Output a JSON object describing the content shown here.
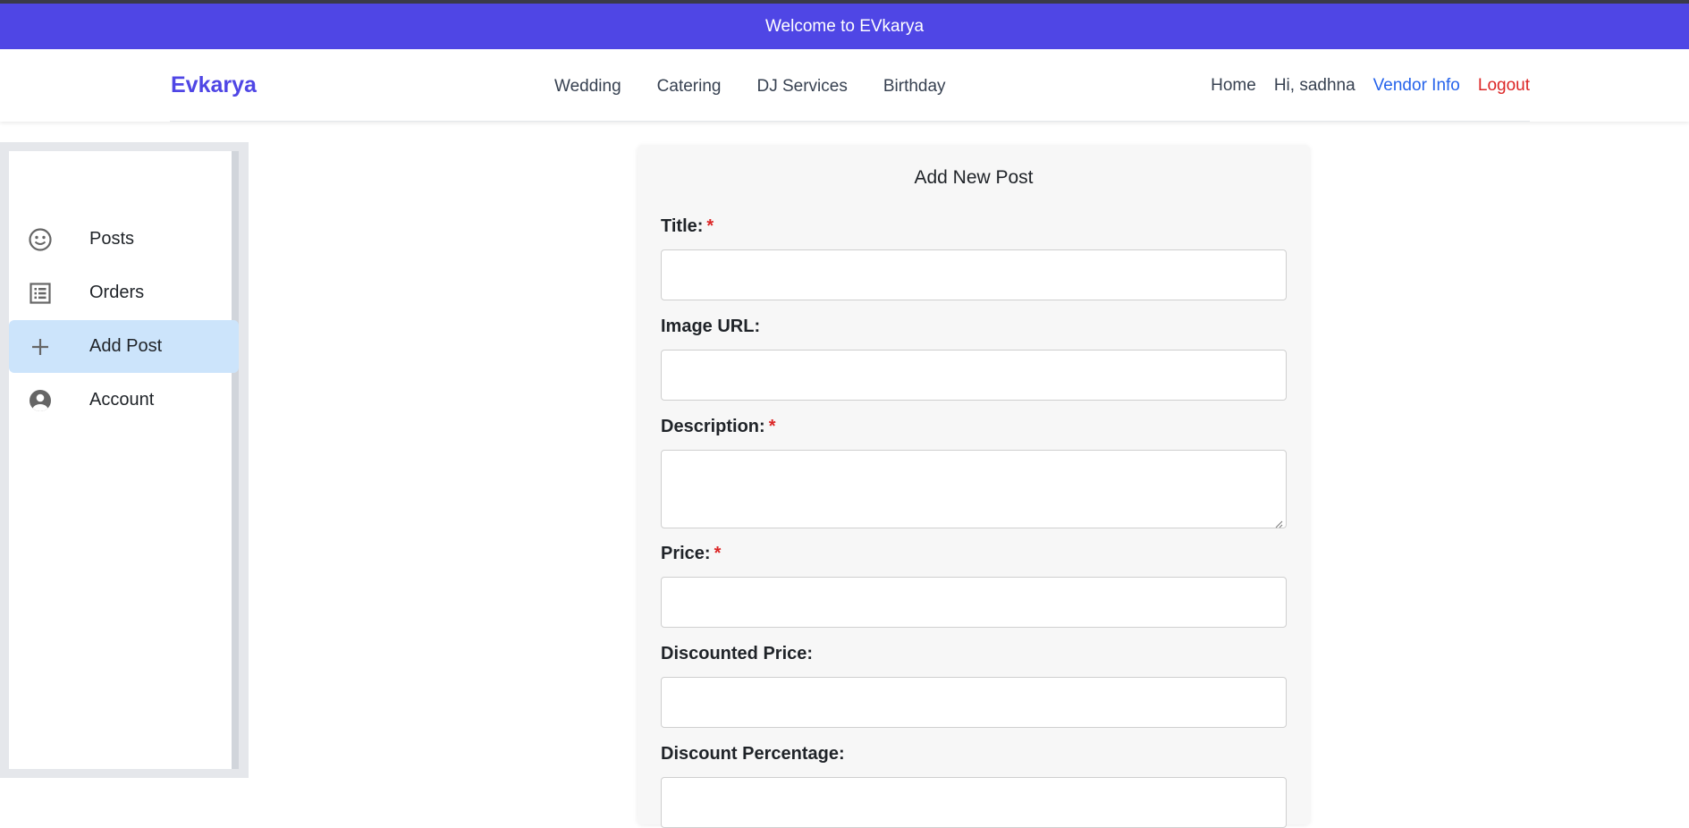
{
  "banner": {
    "text": "Welcome to EVkarya",
    "color": "#4f46e5"
  },
  "navbar": {
    "brand": "Evkarya",
    "categories": [
      "Wedding",
      "Catering",
      "DJ Services",
      "Birthday"
    ],
    "home": "Home",
    "greeting": "Hi, sadhna",
    "vendor_info": "Vendor Info",
    "logout": "Logout"
  },
  "sidebar": {
    "items": [
      {
        "label": "Posts",
        "icon": "smiley-icon"
      },
      {
        "label": "Orders",
        "icon": "list-icon"
      },
      {
        "label": "Add Post",
        "icon": "plus-icon",
        "active": true
      },
      {
        "label": "Account",
        "icon": "account-icon"
      }
    ]
  },
  "form": {
    "title": "Add New Post",
    "required_marker": "*",
    "fields": {
      "title": {
        "label": "Title:",
        "required": true,
        "value": ""
      },
      "image_url": {
        "label": "Image URL:",
        "required": false,
        "value": ""
      },
      "description": {
        "label": "Description:",
        "required": true,
        "value": ""
      },
      "price": {
        "label": "Price:",
        "required": true,
        "value": ""
      },
      "discounted_price": {
        "label": "Discounted Price:",
        "required": false,
        "value": ""
      },
      "discount_percentage": {
        "label": "Discount Percentage:",
        "required": false,
        "value": ""
      }
    }
  },
  "colors": {
    "accent": "#4f46e5",
    "vendor_link": "#2563eb",
    "logout_link": "#dc2626",
    "active_item_bg": "#cce4fb",
    "required": "#dc2626"
  }
}
